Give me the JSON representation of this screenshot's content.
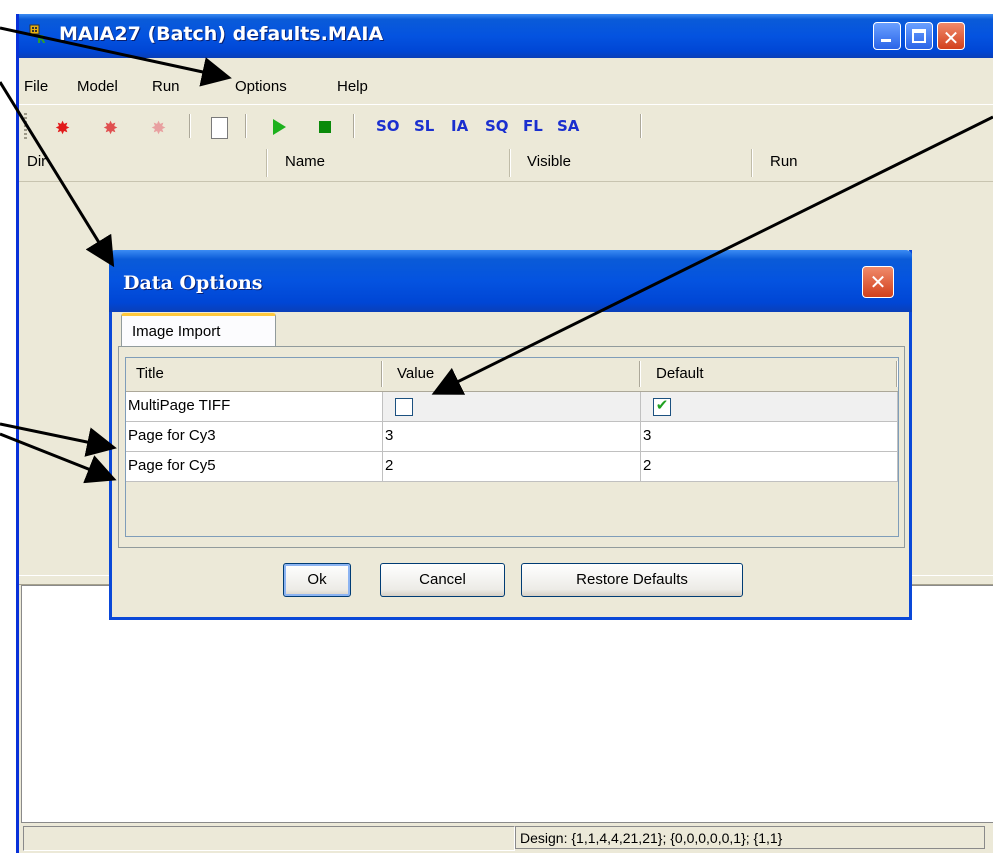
{
  "window": {
    "title": "MAIA27 (Batch) defaults.MAIA",
    "title_controls": [
      "minimize-icon",
      "maximize-icon",
      "close-icon"
    ]
  },
  "menubar": {
    "items": [
      "File",
      "Model",
      "Run",
      "Options",
      "Help"
    ]
  },
  "toolbar": {
    "icons": [
      "bug-icon-red",
      "bug-icon-gray",
      "bug-icon-light",
      "blank-icon",
      "play-icon",
      "stop-icon"
    ],
    "code_buttons": [
      "SO",
      "SL",
      "IA",
      "SQ",
      "FL",
      "SA"
    ],
    "colors": {
      "play": "#1db11d",
      "stop": "#0a8a0a",
      "code_text": "#1a2fcf"
    }
  },
  "main_table": {
    "columns": [
      "Dir",
      "Name",
      "Visible",
      "Run"
    ]
  },
  "status": {
    "left": "",
    "right": "Design: {1,1,4,4,21,21}; {0,0,0,0,0,1}; {1,1}"
  },
  "dialog": {
    "title": "Data Options",
    "tabs": [
      "Image Import"
    ],
    "table": {
      "columns": [
        "Title",
        "Value",
        "Default"
      ],
      "rows": [
        {
          "title": "MultiPage TIFF",
          "value": false,
          "default": true
        },
        {
          "title": "Page for Cy3",
          "value": "3",
          "default": "3"
        },
        {
          "title": "Page for Cy5",
          "value": "2",
          "default": "2"
        }
      ]
    },
    "buttons": {
      "ok": "Ok",
      "cancel": "Cancel",
      "restore": "Restore Defaults"
    }
  },
  "colors": {
    "titlebar": "#0453e0",
    "window_bg": "#ece9d8",
    "check_mark": "#21a121"
  }
}
